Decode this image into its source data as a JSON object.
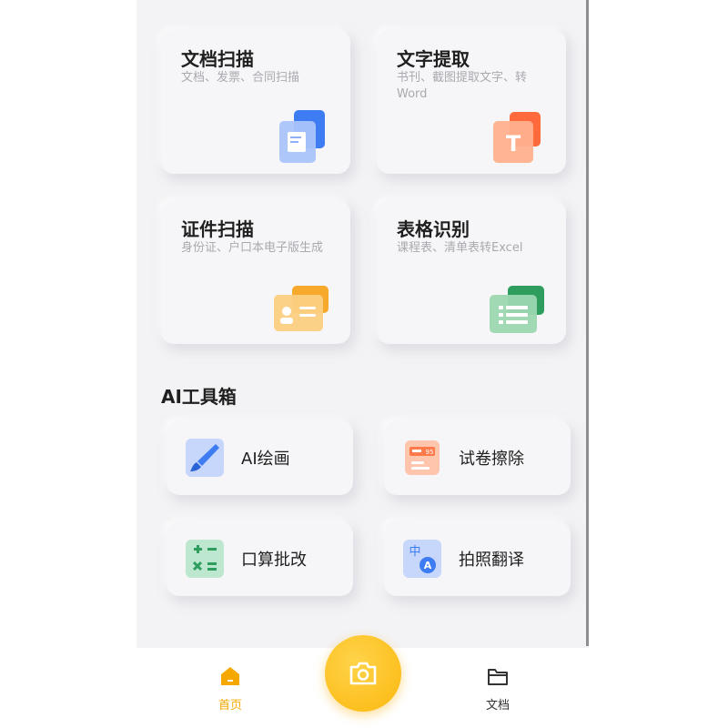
{
  "scan_cards": [
    {
      "title": "文档扫描",
      "subtitle": "文档、发票、合同扫描",
      "icon": "document-icon"
    },
    {
      "title": "文字提取",
      "subtitle": "书刊、截图提取文字、转Word",
      "icon": "text-extract-icon"
    },
    {
      "title": "证件扫描",
      "subtitle": "身份证、户口本电子版生成",
      "icon": "id-card-icon"
    },
    {
      "title": "表格识别",
      "subtitle": "课程表、清单表转Excel",
      "icon": "table-icon"
    }
  ],
  "ai_section": {
    "title": "AI工具箱",
    "tools": [
      {
        "label": "AI绘画",
        "icon": "paintbrush-icon"
      },
      {
        "label": "试卷擦除",
        "icon": "exam-paper-icon"
      },
      {
        "label": "口算批改",
        "icon": "calculator-icon"
      },
      {
        "label": "拍照翻译",
        "icon": "translate-icon"
      }
    ]
  },
  "tabbar": {
    "home_label": "首页",
    "docs_label": "文档",
    "camera_icon": "camera-icon"
  },
  "colors": {
    "accent": "#f5a800",
    "camera": "#fbb80e",
    "blue": "#4a86f5",
    "orange": "#ff7a3d",
    "yellow": "#f5b43a",
    "green": "#3fae6e"
  }
}
